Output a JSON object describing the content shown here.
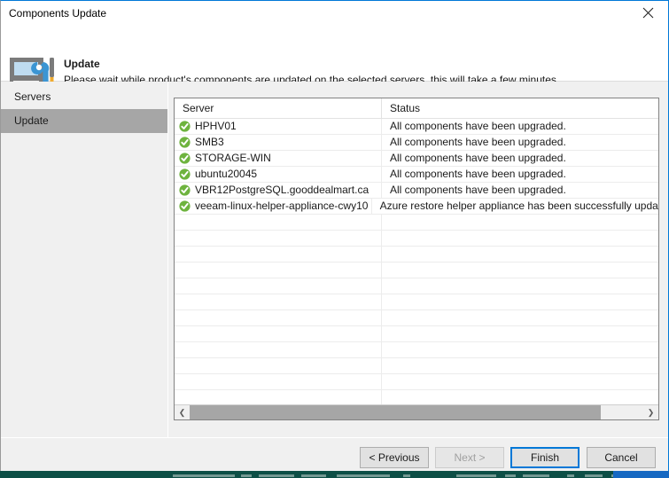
{
  "window": {
    "title": "Components Update",
    "close_icon": "close-icon"
  },
  "banner": {
    "icon": "server-tools-icon",
    "title": "Update",
    "subtitle": "Please wait while product's components are updated on the selected servers, this will take a few minutes."
  },
  "sidebar": {
    "items": [
      {
        "label": "Servers",
        "selected": false
      },
      {
        "label": "Update",
        "selected": true
      }
    ]
  },
  "table": {
    "columns": [
      "Server",
      "Status"
    ],
    "rows": [
      {
        "icon": "success-check-icon",
        "server": "HPHV01",
        "status": "All components have been upgraded."
      },
      {
        "icon": "success-check-icon",
        "server": "SMB3",
        "status": "All components have been upgraded."
      },
      {
        "icon": "success-check-icon",
        "server": "STORAGE-WIN",
        "status": "All components have been upgraded."
      },
      {
        "icon": "success-check-icon",
        "server": "ubuntu20045",
        "status": "All components have been upgraded."
      },
      {
        "icon": "success-check-icon",
        "server": "VBR12PostgreSQL.gooddealmart.ca",
        "status": "All components have been upgraded."
      },
      {
        "icon": "success-check-icon",
        "server": "veeam-linux-helper-appliance-cwy10",
        "status": "Azure restore helper appliance has been successfully updated"
      }
    ],
    "empty_row_count": 12,
    "scrollbar": {
      "left_arrow": "❮",
      "right_arrow": "❯"
    }
  },
  "footer": {
    "previous_label": "< Previous",
    "next_label": "Next >",
    "finish_label": "Finish",
    "cancel_label": "Cancel"
  },
  "colors": {
    "accent": "#0078d7",
    "success": "#6eb33e",
    "selection": "#a6a6a6",
    "panel": "#f0f0f0"
  }
}
